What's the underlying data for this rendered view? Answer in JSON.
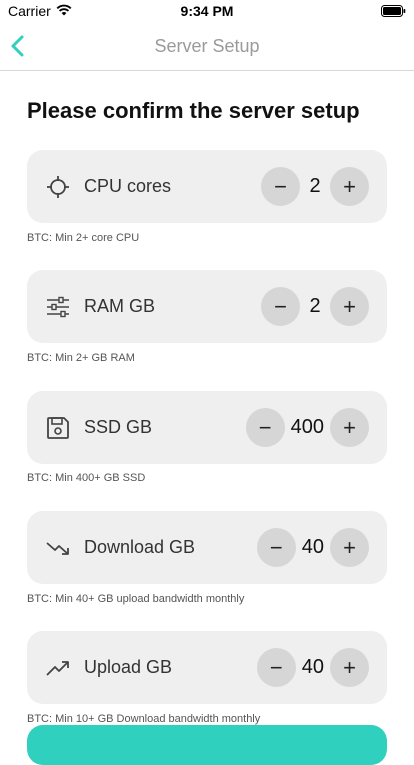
{
  "status_bar": {
    "carrier": "Carrier",
    "time": "9:34 PM"
  },
  "nav": {
    "title": "Server Setup"
  },
  "heading": "Please confirm the server setup",
  "colors": {
    "accent": "#2fd0bd",
    "card_bg": "#efefef",
    "stepper_bg": "#d6d6d6"
  },
  "items": [
    {
      "label": "CPU cores",
      "icon": "crosshair-icon",
      "value": "2",
      "hint": "BTC: Min 2+ core CPU",
      "minus": "−",
      "plus": "+"
    },
    {
      "label": "RAM GB",
      "icon": "sliders-icon",
      "value": "2",
      "hint": "BTC: Min 2+ GB RAM",
      "minus": "−",
      "plus": "+"
    },
    {
      "label": "SSD GB",
      "icon": "floppy-disk-icon",
      "value": "400",
      "hint": "BTC: Min 400+ GB SSD",
      "minus": "−",
      "plus": "+"
    },
    {
      "label": "Download GB",
      "icon": "trend-down-icon",
      "value": "40",
      "hint": "BTC: Min 40+ GB upload bandwidth monthly",
      "minus": "−",
      "plus": "+"
    },
    {
      "label": "Upload GB",
      "icon": "trend-up-icon",
      "value": "40",
      "hint": "BTC: Min 10+ GB Download bandwidth monthly",
      "minus": "−",
      "plus": "+"
    }
  ]
}
